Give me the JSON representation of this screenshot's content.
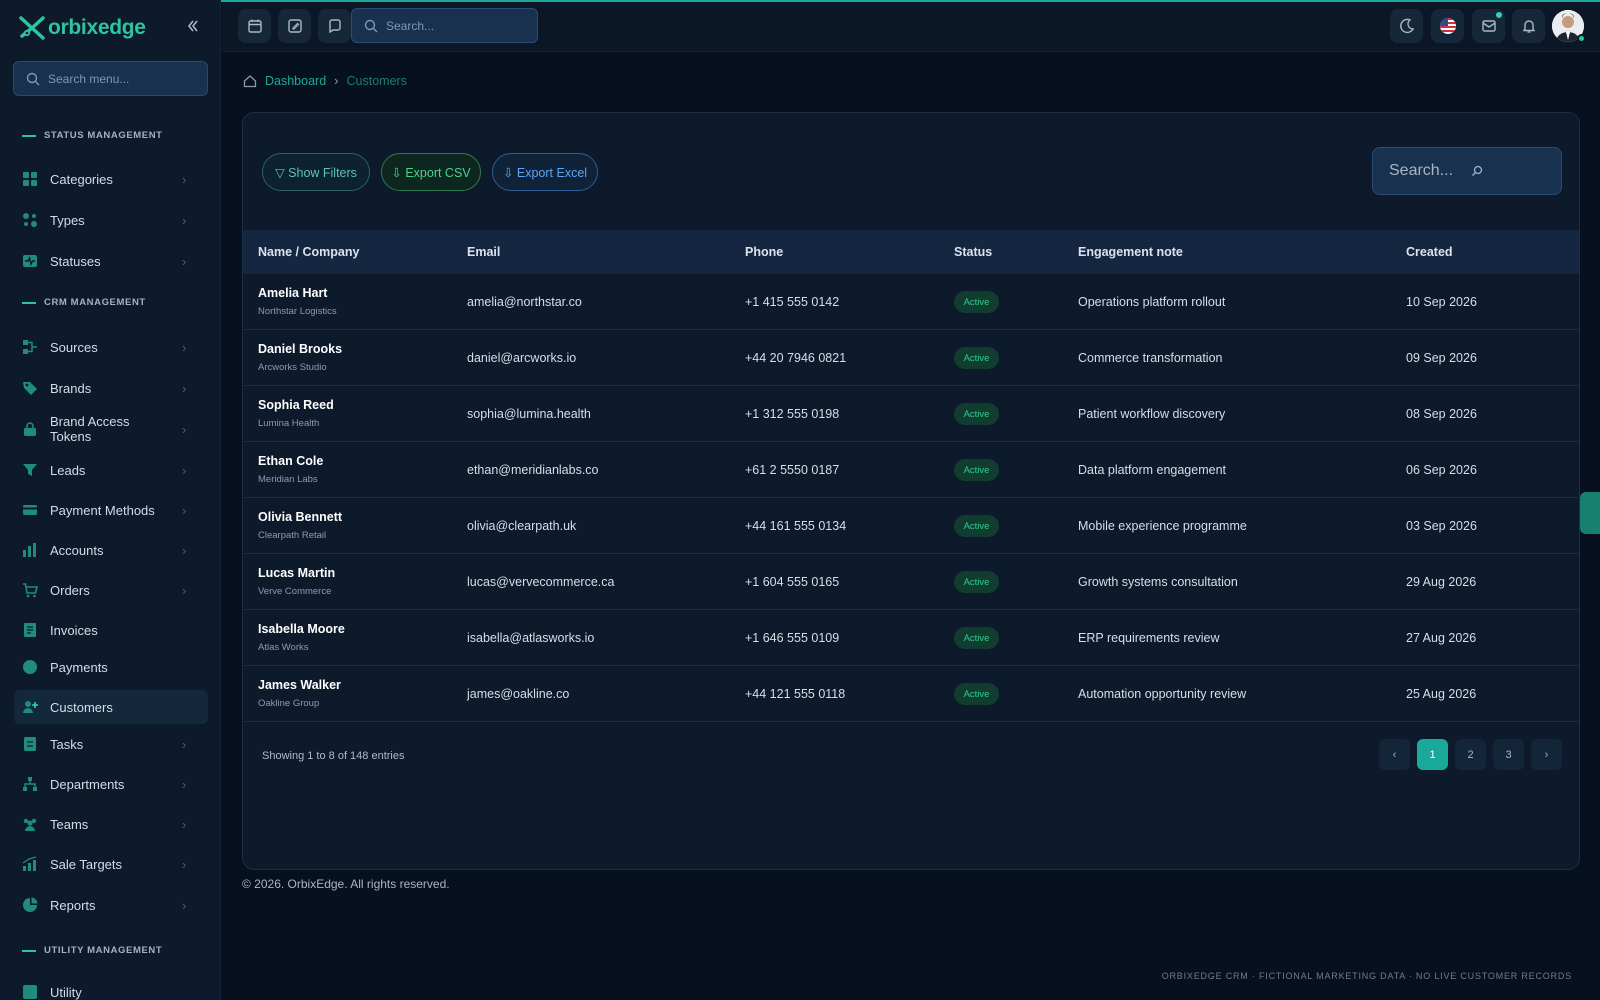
{
  "app": {
    "logo_text": "orbixedge",
    "accent": "#1fa69a"
  },
  "sidebar": {
    "search_placeholder": "Search menu...",
    "sections": [
      {
        "title": "STATUS MANAGEMENT"
      },
      {
        "title": "CRM MANAGEMENT"
      },
      {
        "title": "UTILITY MANAGEMENT"
      }
    ],
    "items": [
      {
        "label": "Categories",
        "icon": "grid-icon"
      },
      {
        "label": "Types",
        "icon": "dots-icon"
      },
      {
        "label": "Statuses",
        "icon": "pulse-icon"
      },
      {
        "label": "Sources",
        "icon": "source-icon"
      },
      {
        "label": "Brands",
        "icon": "tag-icon"
      },
      {
        "label": "Brand Access Tokens",
        "icon": "lock-icon"
      },
      {
        "label": "Leads",
        "icon": "funnel-icon"
      },
      {
        "label": "Payment Methods",
        "icon": "card-icon"
      },
      {
        "label": "Accounts",
        "icon": "bars-icon"
      },
      {
        "label": "Orders",
        "icon": "cart-icon"
      },
      {
        "label": "Invoices",
        "icon": "invoice-icon"
      },
      {
        "label": "Payments",
        "icon": "coin-icon"
      },
      {
        "label": "Customers",
        "icon": "customers-icon",
        "active": true
      },
      {
        "label": "Tasks",
        "icon": "tasks-icon"
      },
      {
        "label": "Departments",
        "icon": "hierarchy-icon"
      },
      {
        "label": "Teams",
        "icon": "team-icon"
      },
      {
        "label": "Sale Targets",
        "icon": "chart-icon"
      },
      {
        "label": "Reports",
        "icon": "pie-icon"
      },
      {
        "label": "Utility",
        "icon": "utility-icon"
      }
    ]
  },
  "topbar": {
    "search_placeholder": "Search..."
  },
  "breadcrumb": {
    "home": "Dashboard",
    "current": "Customers"
  },
  "toolbar": {
    "show_filters": "▽ Show Filters",
    "export_csv": "⇩ Export CSV",
    "export_excel": "⇩ Export Excel",
    "search_placeholder": "Search..."
  },
  "table": {
    "columns": [
      "Name / Company",
      "Email",
      "Phone",
      "Status",
      "Engagement note",
      "Created"
    ],
    "rows": [
      {
        "name": "Amelia Hart",
        "company": "Northstar Logistics",
        "email": "amelia@northstar.co",
        "phone": "+1 415 555 0142",
        "status": "Active",
        "note": "Operations platform rollout",
        "created": "10 Sep 2026"
      },
      {
        "name": "Daniel Brooks",
        "company": "Arcworks Studio",
        "email": "daniel@arcworks.io",
        "phone": "+44 20 7946 0821",
        "status": "Active",
        "note": "Commerce transformation",
        "created": "09 Sep 2026"
      },
      {
        "name": "Sophia Reed",
        "company": "Lumina Health",
        "email": "sophia@lumina.health",
        "phone": "+1 312 555 0198",
        "status": "Active",
        "note": "Patient workflow discovery",
        "created": "08 Sep 2026"
      },
      {
        "name": "Ethan Cole",
        "company": "Meridian Labs",
        "email": "ethan@meridianlabs.co",
        "phone": "+61 2 5550 0187",
        "status": "Active",
        "note": "Data platform engagement",
        "created": "06 Sep 2026"
      },
      {
        "name": "Olivia Bennett",
        "company": "Clearpath Retail",
        "email": "olivia@clearpath.uk",
        "phone": "+44 161 555 0134",
        "status": "Active",
        "note": "Mobile experience programme",
        "created": "03 Sep 2026"
      },
      {
        "name": "Lucas Martin",
        "company": "Verve Commerce",
        "email": "lucas@vervecommerce.ca",
        "phone": "+1 604 555 0165",
        "status": "Active",
        "note": "Growth systems consultation",
        "created": "29 Aug 2026"
      },
      {
        "name": "Isabella Moore",
        "company": "Atlas Works",
        "email": "isabella@atlasworks.io",
        "phone": "+1 646 555 0109",
        "status": "Active",
        "note": "ERP requirements review",
        "created": "27 Aug 2026"
      },
      {
        "name": "James Walker",
        "company": "Oakline Group",
        "email": "james@oakline.co",
        "phone": "+44 121 555 0118",
        "status": "Active",
        "note": "Automation opportunity review",
        "created": "25 Aug 2026"
      }
    ]
  },
  "pagination": {
    "showing": "Showing 1 to 8 of 148 entries",
    "prev": "‹",
    "next": "›",
    "pages": [
      "1",
      "2",
      "3"
    ],
    "current": "1"
  },
  "footer": {
    "copyright": "© 2026. OrbixEdge. All rights reserved."
  },
  "disclaimer": "ORBIXEDGE CRM · FICTIONAL MARKETING DATA · NO LIVE CUSTOMER RECORDS"
}
